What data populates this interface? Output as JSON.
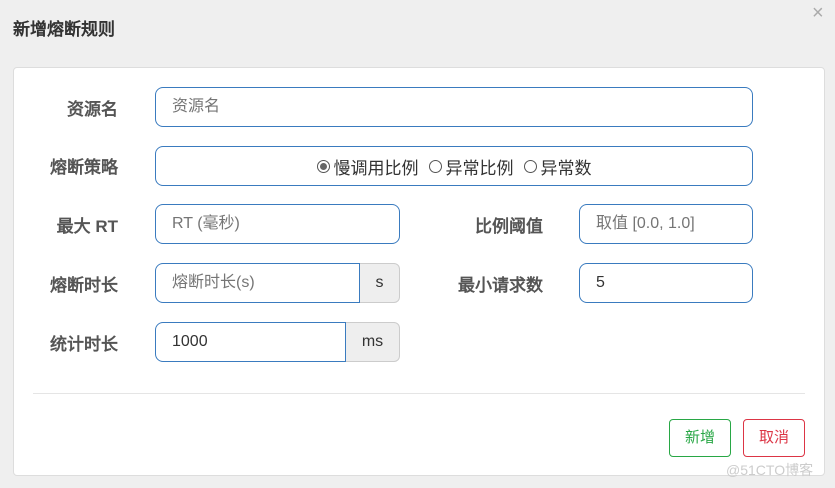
{
  "dialog": {
    "title": "新增熔断规则",
    "close": "×"
  },
  "form": {
    "resource": {
      "label": "资源名",
      "placeholder": "资源名",
      "value": ""
    },
    "strategy": {
      "label": "熔断策略",
      "options": [
        "慢调用比例",
        "异常比例",
        "异常数"
      ],
      "selected": "慢调用比例"
    },
    "max_rt": {
      "label": "最大 RT",
      "placeholder": "RT (毫秒)",
      "value": ""
    },
    "ratio": {
      "label": "比例阈值",
      "placeholder": "取值 [0.0, 1.0]",
      "value": ""
    },
    "duration": {
      "label": "熔断时长",
      "placeholder": "熔断时长(s)",
      "value": "",
      "unit": "s"
    },
    "min_request": {
      "label": "最小请求数",
      "value": "5"
    },
    "stat_interval": {
      "label": "统计时长",
      "value": "1000",
      "unit": "ms"
    }
  },
  "buttons": {
    "add": "新增",
    "cancel": "取消"
  },
  "watermark": "@51CTO博客",
  "colors": {
    "add": "#28a745",
    "cancel": "#dc3545",
    "input_border": "#3a7bbf"
  }
}
